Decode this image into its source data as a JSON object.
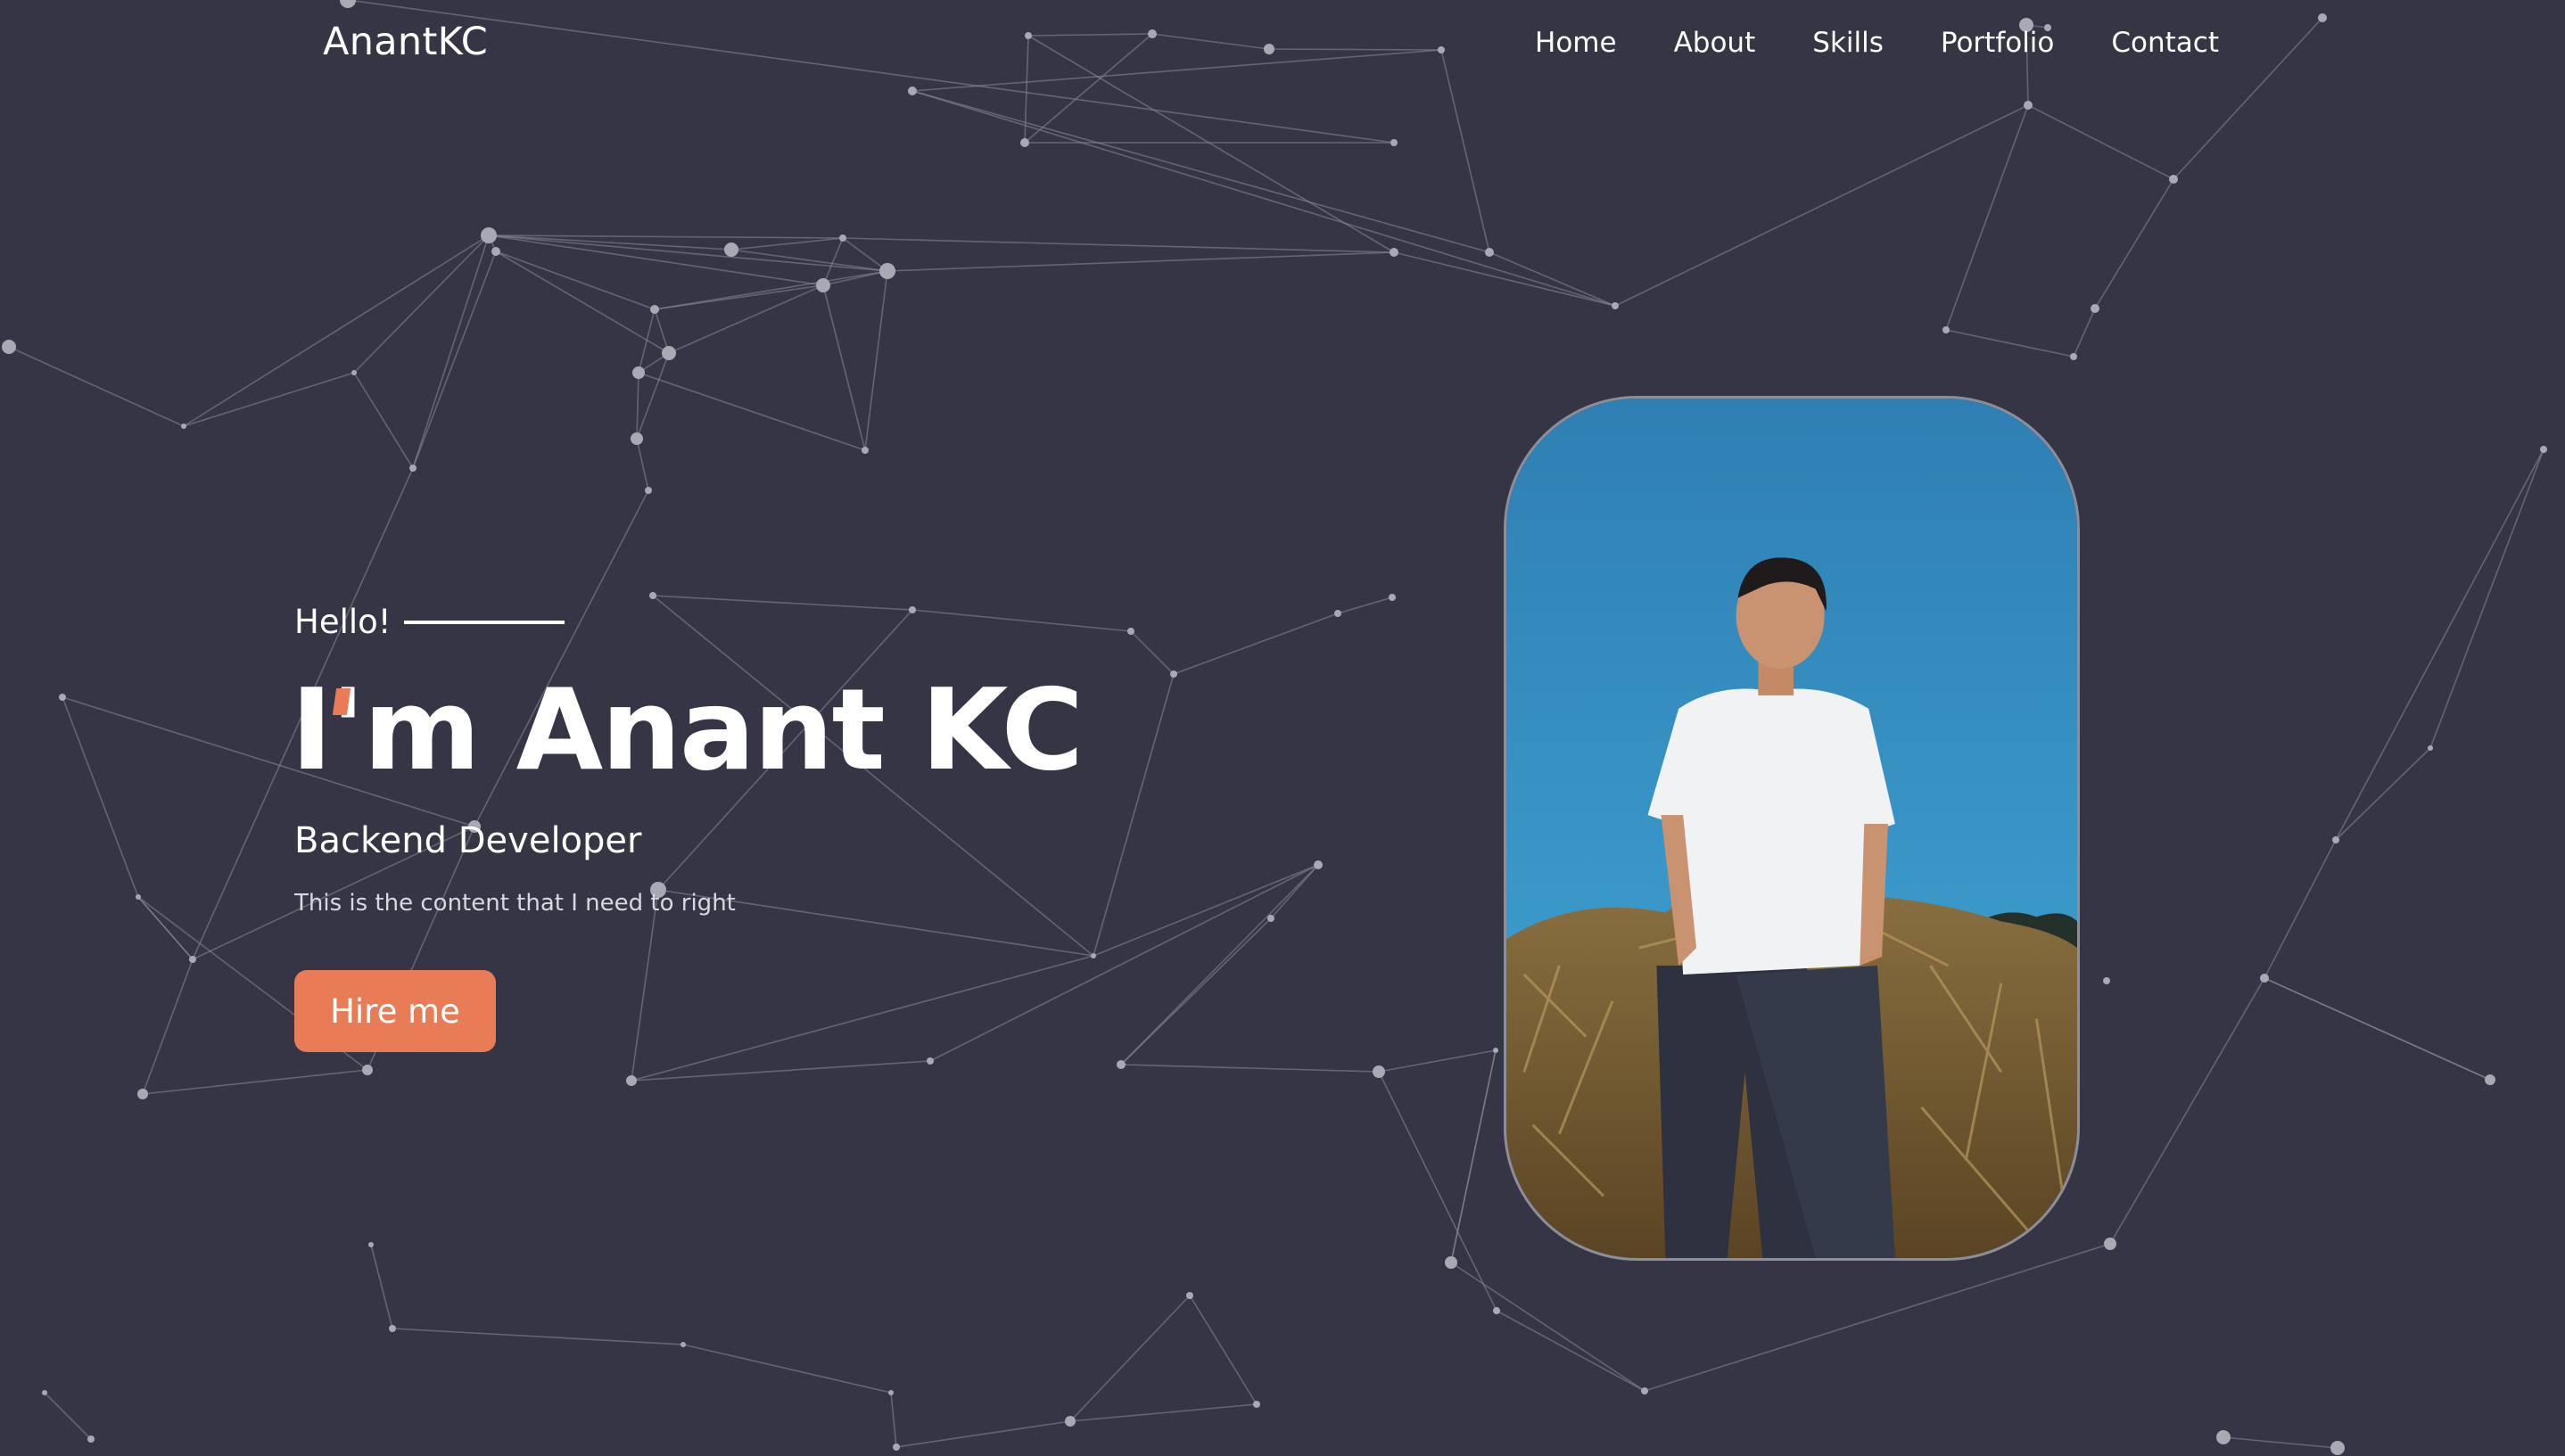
{
  "header": {
    "brand": "AnantKC",
    "nav": [
      {
        "label": "Home"
      },
      {
        "label": "About"
      },
      {
        "label": "Skills"
      },
      {
        "label": "Portfolio"
      },
      {
        "label": "Contact"
      }
    ]
  },
  "hero": {
    "greeting": "Hello!",
    "title": "I'm Anant KC",
    "role": "Backend Developer",
    "description": "This is the content that I need to right",
    "cta_label": "Hire me"
  },
  "colors": {
    "background": "#353546",
    "accent": "#e87c57",
    "network": "#a9a9b4"
  },
  "photo": {
    "icon": "profile-photo"
  }
}
